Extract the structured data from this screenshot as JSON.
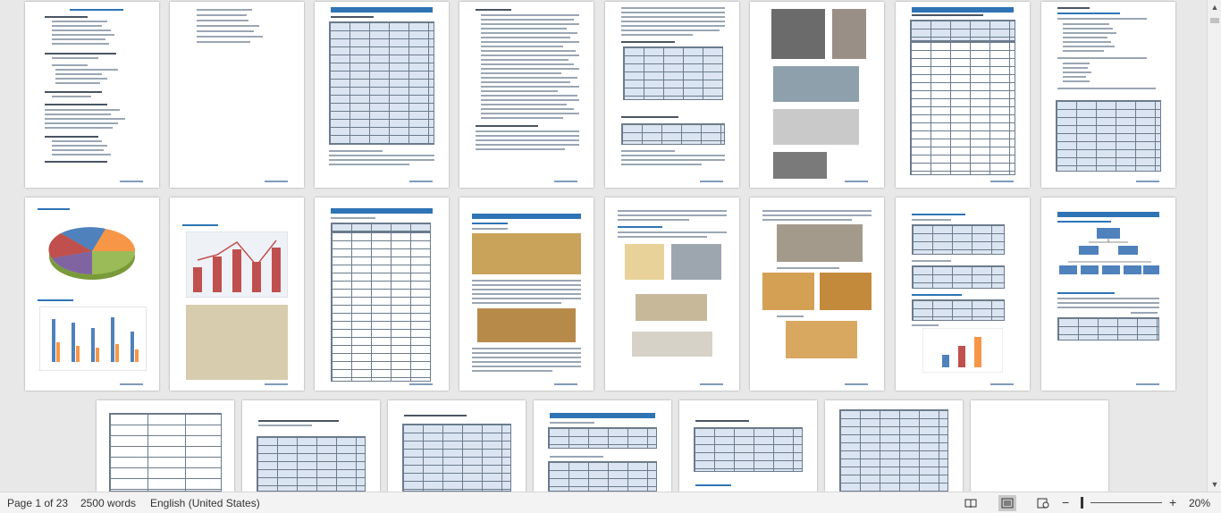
{
  "status_bar": {
    "page_info": "Page 1 of 23",
    "word_count": "2500 words",
    "language": "English (United States)",
    "zoom_minus": "−",
    "zoom_plus": "+",
    "zoom_level": "20%"
  },
  "icons": {
    "read_mode": "book-icon",
    "print_layout": "page-icon",
    "web_layout": "web-icon"
  },
  "colors": {
    "accent": "#2e74b5",
    "background": "#e8e8e8",
    "page": "#ffffff"
  }
}
